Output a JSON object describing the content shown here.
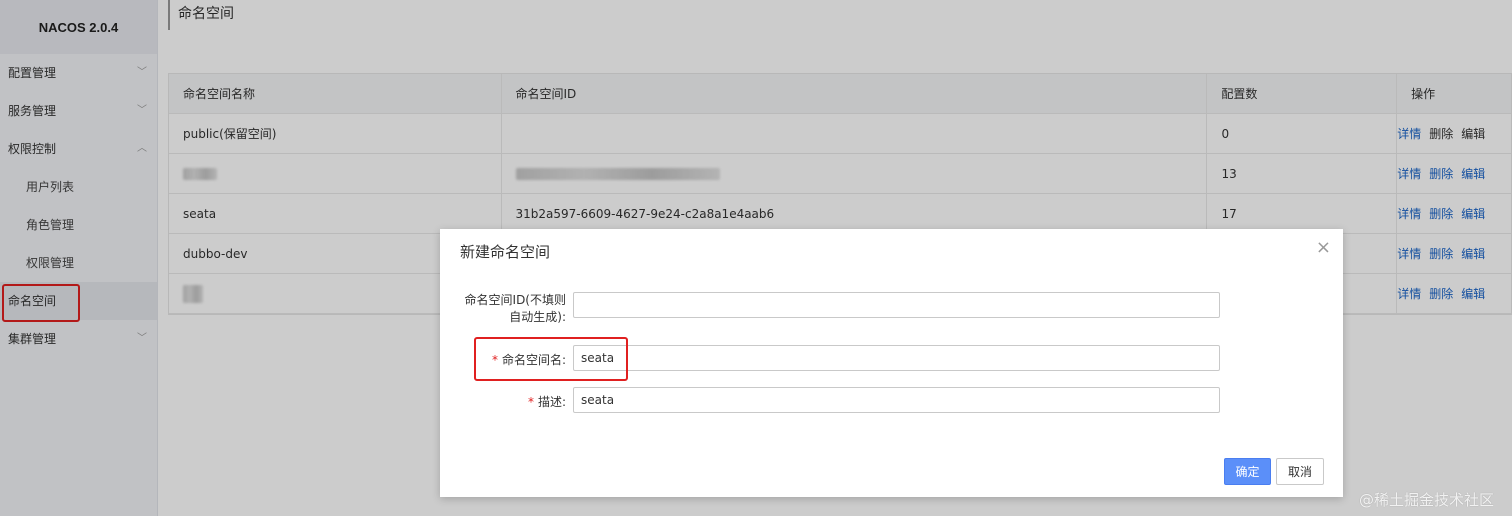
{
  "app": {
    "brand": "NACOS 2.0.4"
  },
  "sidebar": {
    "items": [
      {
        "label": "配置管理",
        "chevron": "﹀"
      },
      {
        "label": "服务管理",
        "chevron": "﹀"
      },
      {
        "label": "权限控制",
        "chevron": "︿"
      },
      {
        "label": "用户列表"
      },
      {
        "label": "角色管理"
      },
      {
        "label": "权限管理"
      },
      {
        "label": "命名空间"
      },
      {
        "label": "集群管理",
        "chevron": "﹀"
      }
    ]
  },
  "page": {
    "title": "命名空间"
  },
  "table": {
    "headers": [
      "命名空间名称",
      "命名空间ID",
      "配置数",
      "操作"
    ],
    "rows": [
      {
        "name": "public(保留空间)",
        "id": "",
        "count": "0"
      },
      {
        "name": "",
        "id": "",
        "count": "13"
      },
      {
        "name": "seata",
        "id": "31b2a597-6609-4627-9e24-c2a8a1e4aab6",
        "count": "17"
      },
      {
        "name": "dubbo-dev",
        "id": "",
        "count": ""
      },
      {
        "name": "",
        "id": "",
        "count": ""
      }
    ],
    "actions": {
      "detail": "详情",
      "delete": "删除",
      "edit": "编辑"
    }
  },
  "dialog": {
    "title": "新建命名空间",
    "close": "×",
    "id_label_line1": "命名空间ID(不填则",
    "id_label_line2": "自动生成):",
    "id_value": "",
    "name_label": "命名空间名:",
    "name_value": "seata",
    "desc_label": "描述:",
    "desc_value": "seata",
    "required_mark": "*",
    "ok": "确定",
    "cancel": "取消"
  },
  "watermark": "@稀土掘金技术社区",
  "colors": {
    "accent": "#5b8ff9",
    "link": "#1a64c8",
    "highlight": "#e02020"
  }
}
